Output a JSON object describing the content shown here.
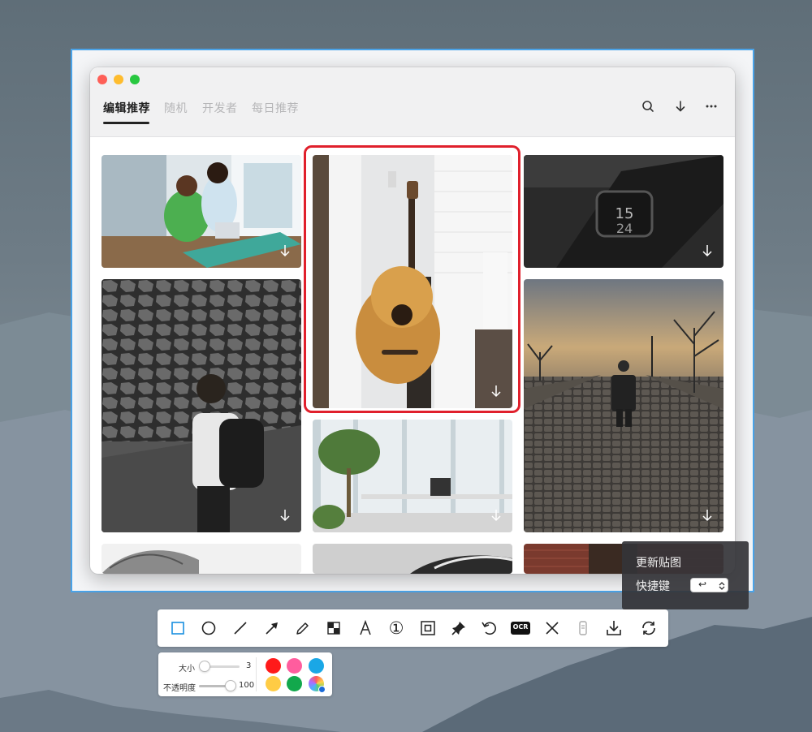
{
  "tabs": [
    {
      "label": "编辑推荐",
      "active": true
    },
    {
      "label": "随机",
      "active": false
    },
    {
      "label": "开发者",
      "active": false
    },
    {
      "label": "每日推荐",
      "active": false
    }
  ],
  "header_icons": [
    "search-icon",
    "download-icon",
    "more-icon"
  ],
  "photos": [
    {
      "name": "photo-office-women",
      "column": 1
    },
    {
      "name": "photo-guitar",
      "column": 2,
      "highlighted": true
    },
    {
      "name": "photo-smartwatch",
      "column": 3
    },
    {
      "name": "photo-man-backpack",
      "column": 1
    },
    {
      "name": "photo-office-interior",
      "column": 2
    },
    {
      "name": "photo-man-cobblestone",
      "column": 3
    },
    {
      "name": "photo-partial-1",
      "column": 1
    },
    {
      "name": "photo-partial-2",
      "column": 2
    },
    {
      "name": "photo-partial-3",
      "column": 3
    }
  ],
  "popup": {
    "update_label": "更新贴图",
    "shortcut_label": "快捷键",
    "shortcut_value": "↩"
  },
  "toolbar": {
    "tools": [
      "rectangle",
      "ellipse",
      "line",
      "arrow",
      "pencil",
      "mosaic",
      "text",
      "serial-number",
      "border",
      "pin",
      "undo",
      "OCR",
      "close",
      "long-screenshot",
      "save",
      "refresh"
    ],
    "ocr_label": "OCR",
    "number_label": "①"
  },
  "subbar": {
    "size_label": "大小",
    "size_value": "3",
    "opacity_label": "不透明度",
    "opacity_value": "100",
    "colors": [
      "#ff1a1a",
      "#ff5d9e",
      "#1aa7e6",
      "#ffcc45",
      "#12a84c",
      "custom"
    ]
  }
}
